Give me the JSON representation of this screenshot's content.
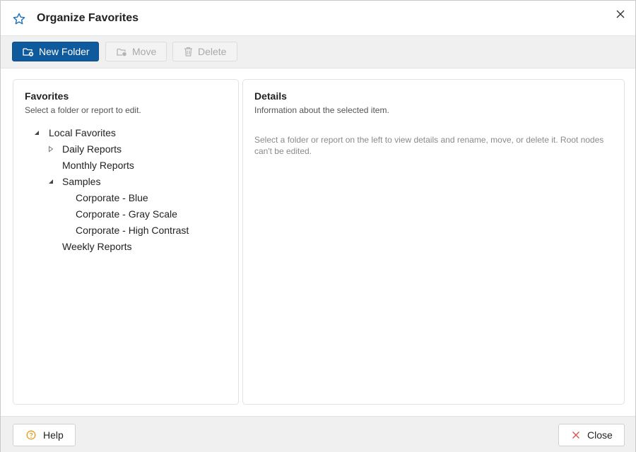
{
  "dialog": {
    "title": "Organize Favorites",
    "icons": {
      "title": "star-icon",
      "close": "close-icon"
    }
  },
  "toolbar": {
    "new_folder_label": "New Folder",
    "move_label": "Move",
    "delete_label": "Delete",
    "icons": {
      "new_folder": "folder-add-icon",
      "move": "folder-move-icon",
      "delete": "trash-icon"
    }
  },
  "favorites": {
    "title": "Favorites",
    "subtitle": "Select a folder or report to edit.",
    "tree": [
      {
        "label": "Local Favorites",
        "toggle": "expanded"
      },
      {
        "label": "Daily Reports",
        "toggle": "collapsed"
      },
      {
        "label": "Monthly Reports",
        "toggle": "none"
      },
      {
        "label": "Samples",
        "toggle": "expanded"
      },
      {
        "label": "Corporate - Blue",
        "toggle": "none"
      },
      {
        "label": "Corporate - Gray Scale",
        "toggle": "none"
      },
      {
        "label": "Corporate - High Contrast",
        "toggle": "none"
      },
      {
        "label": "Weekly Reports",
        "toggle": "none"
      }
    ]
  },
  "details": {
    "title": "Details",
    "subtitle": "Information about the selected item.",
    "hint": "Select a folder or report on the left to view details and rename, move, or delete it. Root nodes can't be edited."
  },
  "footer": {
    "help_label": "Help",
    "close_label": "Close",
    "icons": {
      "help": "help-circle-icon",
      "close": "close-icon"
    }
  },
  "colors": {
    "primary": "#0f5a9c",
    "accent_icon": "#1f6fb8",
    "help_icon": "#e0a020",
    "close_icon": "#d9534f"
  }
}
